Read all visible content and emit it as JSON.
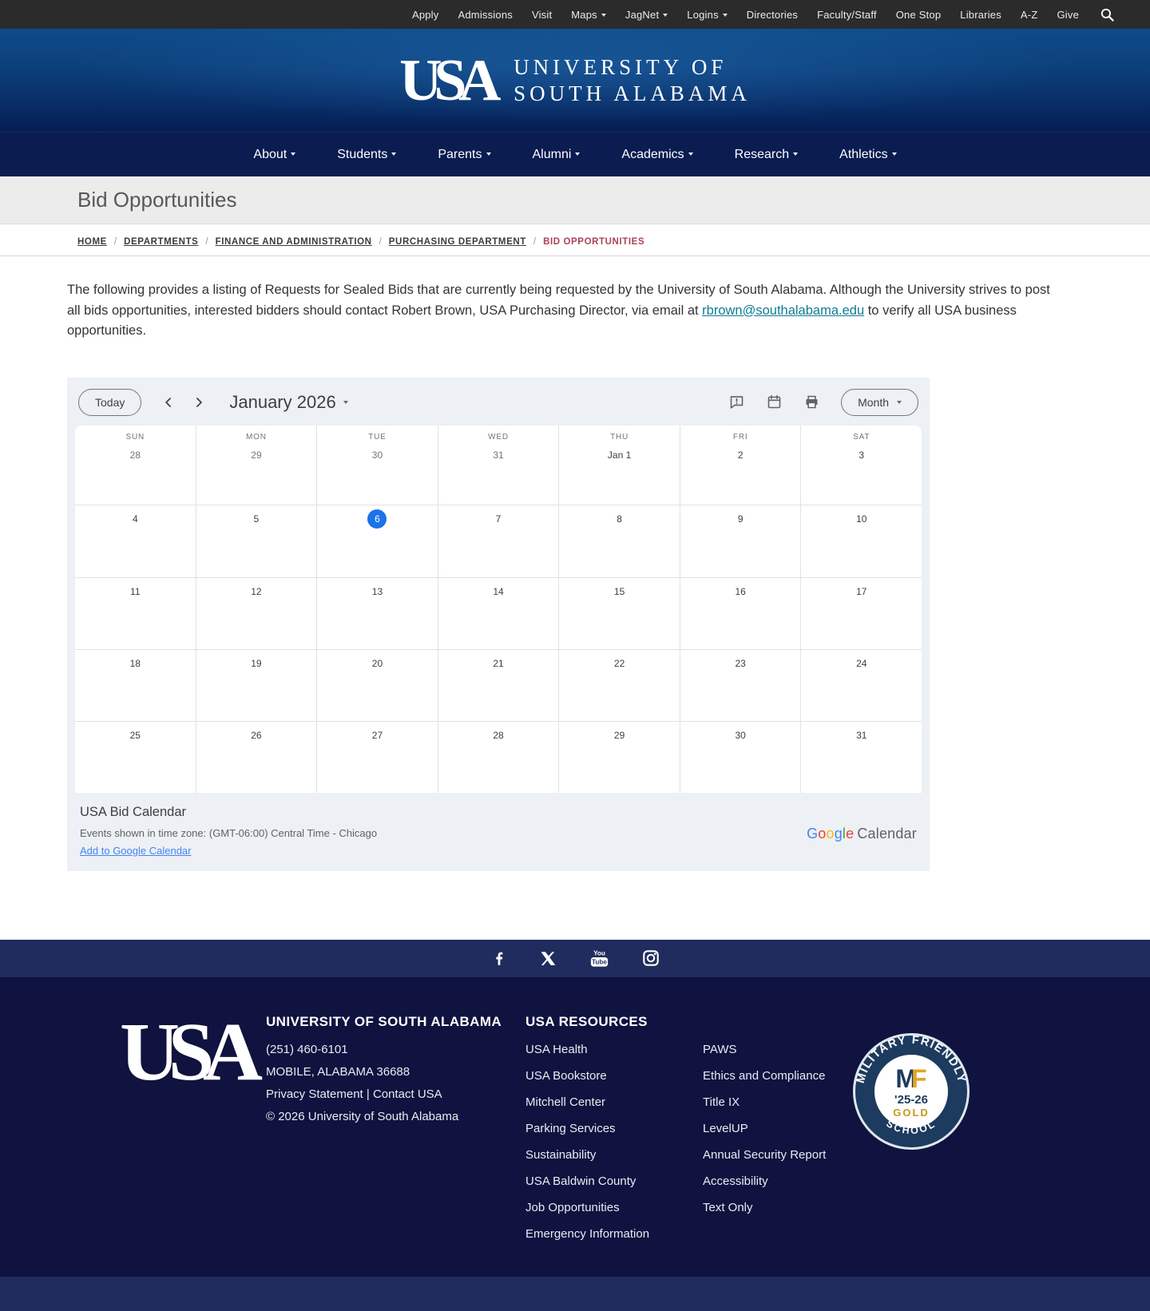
{
  "utility_nav": {
    "items": [
      {
        "label": "Apply",
        "dropdown": false
      },
      {
        "label": "Admissions",
        "dropdown": false
      },
      {
        "label": "Visit",
        "dropdown": false
      },
      {
        "label": "Maps",
        "dropdown": true
      },
      {
        "label": "JagNet",
        "dropdown": true
      },
      {
        "label": "Logins",
        "dropdown": true
      },
      {
        "label": "Directories",
        "dropdown": false
      },
      {
        "label": "Faculty/Staff",
        "dropdown": false
      },
      {
        "label": "One Stop",
        "dropdown": false
      },
      {
        "label": "Libraries",
        "dropdown": false
      },
      {
        "label": "A-Z",
        "dropdown": false
      },
      {
        "label": "Give",
        "dropdown": false
      }
    ]
  },
  "header": {
    "monogram": "USA",
    "wordmark_line1": "UNIVERSITY OF",
    "wordmark_line2": "SOUTH ALABAMA"
  },
  "main_nav": {
    "items": [
      {
        "label": "About"
      },
      {
        "label": "Students"
      },
      {
        "label": "Parents"
      },
      {
        "label": "Alumni"
      },
      {
        "label": "Academics"
      },
      {
        "label": "Research"
      },
      {
        "label": "Athletics"
      }
    ]
  },
  "page": {
    "title": "Bid Opportunities"
  },
  "breadcrumb": {
    "separator": "/",
    "items": [
      {
        "label": "HOME",
        "current": false
      },
      {
        "label": "DEPARTMENTS",
        "current": false
      },
      {
        "label": "FINANCE AND ADMINISTRATION",
        "current": false
      },
      {
        "label": "PURCHASING DEPARTMENT",
        "current": false
      },
      {
        "label": "BID OPPORTUNITIES",
        "current": true
      }
    ]
  },
  "intro": {
    "before": "The following provides a listing of Requests for Sealed Bids that are currently being requested by the University of South Alabama. Although the University strives to post all bids opportunities, interested bidders should contact Robert Brown, USA Purchasing Director,  via email at ",
    "link": "rbrown@southalabama.edu",
    "after": " to verify all USA business opportunities."
  },
  "calendar": {
    "toolbar": {
      "today": "Today",
      "title": "January 2026",
      "view": "Month"
    },
    "day_headers": [
      "SUN",
      "MON",
      "TUE",
      "WED",
      "THU",
      "FRI",
      "SAT"
    ],
    "weeks": [
      [
        {
          "t": "28",
          "muted": true
        },
        {
          "t": "29",
          "muted": true
        },
        {
          "t": "30",
          "muted": true
        },
        {
          "t": "31",
          "muted": true
        },
        {
          "t": "Jan 1"
        },
        {
          "t": "2"
        },
        {
          "t": "3"
        }
      ],
      [
        {
          "t": "4"
        },
        {
          "t": "5"
        },
        {
          "t": "6",
          "today": true
        },
        {
          "t": "7"
        },
        {
          "t": "8"
        },
        {
          "t": "9"
        },
        {
          "t": "10"
        }
      ],
      [
        {
          "t": "11"
        },
        {
          "t": "12"
        },
        {
          "t": "13"
        },
        {
          "t": "14"
        },
        {
          "t": "15"
        },
        {
          "t": "16"
        },
        {
          "t": "17"
        }
      ],
      [
        {
          "t": "18"
        },
        {
          "t": "19"
        },
        {
          "t": "20"
        },
        {
          "t": "21"
        },
        {
          "t": "22"
        },
        {
          "t": "23"
        },
        {
          "t": "24"
        }
      ],
      [
        {
          "t": "25"
        },
        {
          "t": "26"
        },
        {
          "t": "27"
        },
        {
          "t": "28"
        },
        {
          "t": "29"
        },
        {
          "t": "30"
        },
        {
          "t": "31"
        }
      ]
    ],
    "today_color": "#1a73e8",
    "footer": {
      "title": "USA Bid Calendar",
      "timezone": "Events shown in time zone: (GMT-06:00) Central Time - Chicago",
      "add_link": "Add to Google Calendar",
      "google_letters": [
        {
          "c": "G",
          "color": "#4285F4"
        },
        {
          "c": "o",
          "color": "#EA4335"
        },
        {
          "c": "o",
          "color": "#FBBC05"
        },
        {
          "c": "g",
          "color": "#4285F4"
        },
        {
          "c": "l",
          "color": "#34A853"
        },
        {
          "c": "e",
          "color": "#EA4335"
        }
      ],
      "calendar_word": "Calendar"
    }
  },
  "social": {
    "icons": [
      "facebook",
      "x",
      "youtube",
      "instagram"
    ]
  },
  "footer": {
    "brand": {
      "monogram": "USA",
      "name": "UNIVERSITY OF SOUTH ALABAMA",
      "phone": "(251) 460-6101",
      "address": "MOBILE, ALABAMA 36688",
      "links": [
        {
          "label": "Privacy Statement"
        },
        {
          "label": "Contact USA"
        }
      ],
      "link_separator": "|",
      "copyright": "© 2026 University of South Alabama"
    },
    "resources": {
      "heading": "USA RESOURCES",
      "column1": [
        "USA Health",
        "USA Bookstore",
        "Mitchell Center",
        "Parking Services",
        "Sustainability",
        "USA Baldwin County",
        "Job Opportunities",
        "Emergency Information"
      ],
      "column2": [
        "PAWS",
        "Ethics and Compliance",
        "Title IX",
        "LevelUP",
        "Annual Security Report",
        "Accessibility",
        "Text Only"
      ]
    },
    "badge": {
      "arc_top": "MILITARY FRIENDLY",
      "arc_bottom": "SCHOOL",
      "mark_m": "M",
      "mark_f": "F",
      "years": "'25-26",
      "level": "GOLD"
    }
  },
  "colors": {
    "utility_bar": "#2b2b2b",
    "header_blue": "#0c3f7a",
    "nav_navy": "#0a1c50",
    "footer_navy": "#10123f",
    "band_navy": "#212c5e",
    "breadcrumb_current": "#ab4357",
    "link_teal": "#0f7b93",
    "today_blue": "#1a73e8"
  }
}
